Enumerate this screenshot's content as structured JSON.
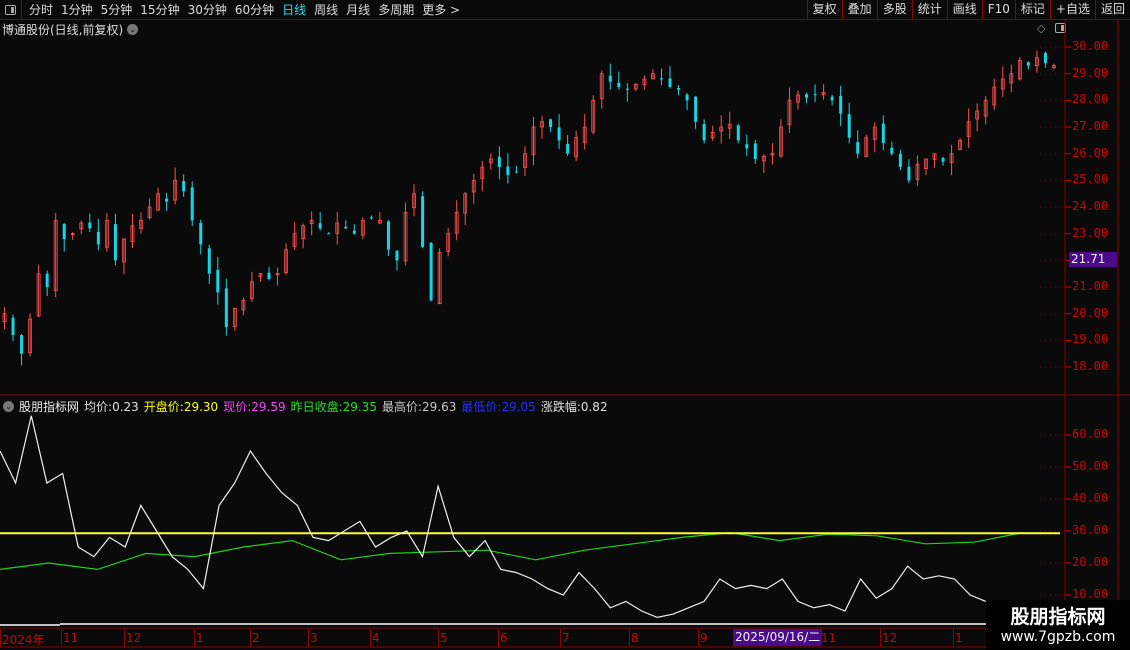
{
  "toolbar": {
    "periods": [
      "分时",
      "1分钟",
      "5分钟",
      "15分钟",
      "30分钟",
      "60分钟",
      "日线",
      "周线",
      "月线",
      "多周期",
      "更多 >"
    ],
    "active": "日线",
    "right": [
      "复权",
      "叠加",
      "多股",
      "统计",
      "画线",
      "F10",
      "标记",
      "+自选",
      "返回"
    ]
  },
  "chart_title": "博通股份(日线,前复权)",
  "price_axis": [
    "30.00",
    "29.00",
    "28.00",
    "27.00",
    "26.00",
    "25.00",
    "24.00",
    "23.00",
    "21.00",
    "20.00",
    "19.00",
    "18.00"
  ],
  "current_price_label": "21.71",
  "indicator": {
    "name": "股朋指标网",
    "items": [
      {
        "label": "均价:",
        "value": "0.23",
        "color": "#e0e0e0"
      },
      {
        "label": "开盘价:",
        "value": "29.30",
        "color": "#ffff00"
      },
      {
        "label": "现价:",
        "value": "29.59",
        "color": "#ff40ff"
      },
      {
        "label": "昨日收盘:",
        "value": "29.35",
        "color": "#20e020"
      },
      {
        "label": "最高价:",
        "value": "29.63",
        "color": "#c8c8c8"
      },
      {
        "label": "最低价:",
        "value": "29.05",
        "color": "#2030ff"
      },
      {
        "label": "涨跌幅:",
        "value": "0.82",
        "color": "#e0e0e0"
      }
    ]
  },
  "indicator_axis": [
    "60.00",
    "50.00",
    "40.00",
    "30.00",
    "20.00",
    "10.00"
  ],
  "date_axis": [
    "2024年",
    "11",
    "12",
    "1",
    "2",
    "3",
    "4",
    "5",
    "6",
    "7",
    "8",
    "9",
    "11",
    "12",
    "1"
  ],
  "date_selected": "2025/09/16/二",
  "watermark": {
    "name": "股朋指标网",
    "url": "www.7gpzb.com"
  },
  "colors": {
    "up": "#ff5050",
    "down": "#10d8e8",
    "axis": "#d40000",
    "border": "#8b0000",
    "yellow": "#ffff30",
    "green": "#20d020",
    "white": "#f0f0f0"
  },
  "chart_data": {
    "type": "candlestick",
    "ylim": [
      17.5,
      30.2
    ],
    "closes": [
      20.0,
      19.2,
      18.5,
      19.8,
      21.5,
      21.0,
      23.5,
      22.8,
      23.0,
      23.4,
      23.2,
      22.6,
      23.5,
      22.0,
      22.8,
      23.3,
      23.5,
      24.0,
      24.5,
      24.2,
      25.0,
      24.6,
      23.5,
      22.6,
      21.5,
      20.8,
      19.5,
      20.2,
      20.5,
      21.2,
      21.5,
      21.3,
      21.5,
      22.4,
      23.0,
      23.3,
      23.5,
      23.2,
      23.0,
      23.4,
      23.2,
      23.0,
      23.5,
      23.6,
      23.5,
      22.4,
      22.0,
      23.8,
      24.5,
      22.5,
      20.5,
      22.3,
      23.0,
      23.8,
      24.5,
      25.0,
      25.5,
      25.8,
      25.5,
      25.2,
      25.3,
      26.0,
      27.0,
      27.2,
      27.0,
      26.5,
      26.0,
      26.6,
      27.0,
      28.0,
      29.0,
      28.7,
      28.5,
      28.4,
      28.6,
      28.8,
      29.0,
      28.8,
      28.5,
      28.4,
      28.0,
      27.2,
      26.5,
      26.8,
      27.0,
      27.1,
      26.5,
      26.2,
      25.8,
      25.9,
      26.0,
      27.0,
      28.0,
      28.2,
      28.1,
      28.2,
      28.3,
      28.0,
      27.5,
      26.6,
      26.0,
      26.6,
      27.0,
      26.4,
      26.0,
      25.5,
      25.0,
      25.6,
      25.8,
      26.0,
      25.7,
      26.0,
      26.5,
      27.2,
      27.6,
      28.0,
      28.5,
      28.8,
      29.0,
      29.5,
      29.3,
      29.6,
      29.4,
      29.3
    ],
    "indicator": {
      "ylim": [
        5,
        70
      ],
      "yellow_level": 29.3,
      "white": [
        55,
        45,
        66,
        45,
        48,
        25,
        22,
        28,
        25,
        38,
        30,
        22,
        18,
        12,
        38,
        45,
        55,
        48,
        42,
        38,
        28,
        27,
        30,
        33,
        25,
        28,
        30,
        22,
        44,
        28,
        22,
        27,
        18,
        17,
        15,
        12,
        10,
        17,
        12,
        6,
        8,
        5,
        3,
        4,
        6,
        8,
        15,
        12,
        13,
        12,
        15,
        8,
        6,
        7,
        5,
        15,
        9,
        12,
        19,
        15,
        16,
        15,
        10,
        8
      ],
      "white_span": 0.93,
      "green": [
        18,
        20,
        18,
        23,
        22,
        25,
        27,
        21,
        23,
        23.5,
        24,
        21,
        24,
        26,
        28,
        29.5,
        27,
        29,
        28.5,
        26,
        26.5,
        29.5
      ],
      "green_span": 0.965
    }
  }
}
